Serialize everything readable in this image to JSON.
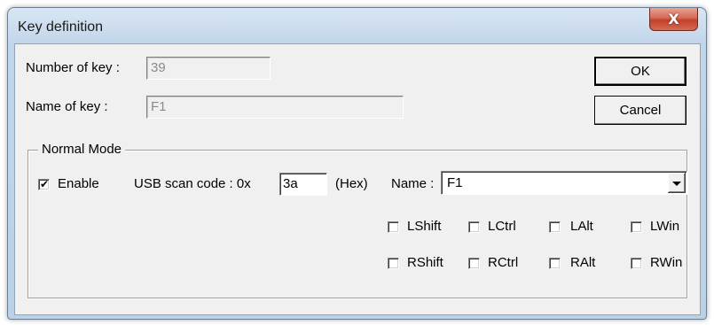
{
  "window": {
    "title": "Key definition",
    "close_glyph": "X"
  },
  "fields": {
    "number_of_key_label": "Number of key :",
    "number_of_key_value": "39",
    "name_of_key_label": "Name of key :",
    "name_of_key_value": "F1"
  },
  "buttons": {
    "ok_label": "OK",
    "cancel_label": "Cancel"
  },
  "normal_mode": {
    "group_label": "Normal Mode",
    "enable_label": "Enable",
    "enable_checked": true,
    "scan_code_label": "USB scan code : 0x",
    "scan_code_value": "3a",
    "hex_label": "(Hex)",
    "name_label": "Name :",
    "name_value": "F1",
    "modifiers": [
      {
        "label": "LShift",
        "checked": false
      },
      {
        "label": "LCtrl",
        "checked": false
      },
      {
        "label": "LAlt",
        "checked": false
      },
      {
        "label": "LWin",
        "checked": false
      },
      {
        "label": "RShift",
        "checked": false
      },
      {
        "label": "RCtrl",
        "checked": false
      },
      {
        "label": "RAlt",
        "checked": false
      },
      {
        "label": "RWin",
        "checked": false
      }
    ]
  }
}
